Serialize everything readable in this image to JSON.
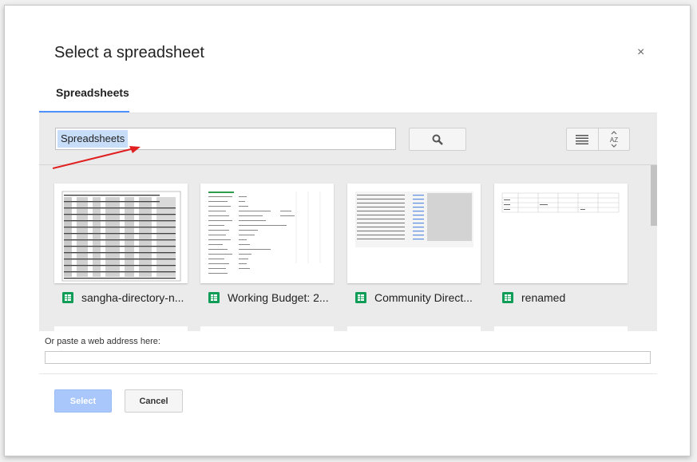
{
  "dialog": {
    "title": "Select a spreadsheet",
    "close_icon": "close-icon",
    "close_glyph": "×"
  },
  "tabs": [
    {
      "label": "Spreadsheets",
      "active": true
    }
  ],
  "search": {
    "chip_label": "Spreadsheets",
    "search_icon": "search-icon"
  },
  "view": {
    "list_icon": "list-view-icon",
    "sort_icon": "sort-az-icon",
    "sort_text": "AZ"
  },
  "files": [
    {
      "name": "sangha-directory-n...",
      "icon": "sheets-icon"
    },
    {
      "name": "Working Budget: 2...",
      "icon": "sheets-icon"
    },
    {
      "name": "Community Direct...",
      "icon": "sheets-icon"
    },
    {
      "name": "renamed",
      "icon": "sheets-icon"
    }
  ],
  "paste": {
    "label": "Or paste a web address here:",
    "value": ""
  },
  "footer": {
    "select_label": "Select",
    "cancel_label": "Cancel"
  },
  "colors": {
    "accent": "#4d90fe",
    "sheets_green": "#0f9d58",
    "annotation_arrow": "#e02020"
  }
}
